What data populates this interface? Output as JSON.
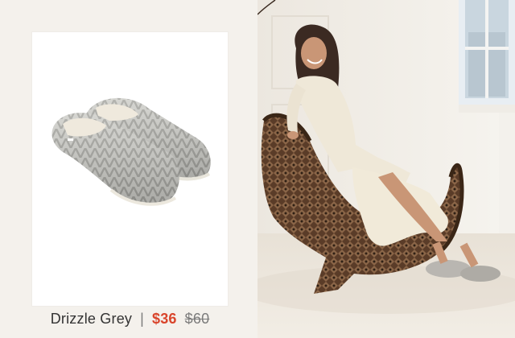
{
  "product": {
    "name": "Drizzle Grey",
    "separator": "|",
    "sale_price": "$36",
    "original_price": "$60"
  },
  "colors": {
    "background": "#f4f1ec",
    "card": "#ffffff",
    "sale_price": "#d9452c",
    "text": "#333333"
  }
}
